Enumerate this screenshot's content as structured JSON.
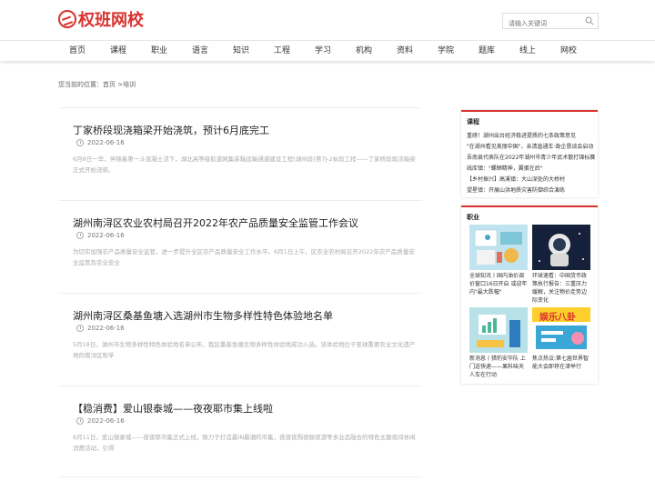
{
  "header": {
    "logo_text": "权班网校",
    "search_placeholder": "请输入关键词"
  },
  "nav": {
    "items": [
      "首页",
      "课程",
      "职业",
      "语言",
      "知识",
      "工程",
      "学习",
      "机构",
      "资料",
      "学院",
      "题库",
      "线上",
      "网校"
    ]
  },
  "breadcrumb": {
    "text": "您当前的位置：首页 >培训"
  },
  "articles": [
    {
      "title": "丁家桥段现浇箱梁开始浇筑，预计6月底完工",
      "date": "2022-06-16",
      "summary": "6月8日一早，伴随着第一斗混凝土浇下，湖北高等级航道网集装箱运输通道建设工程(湖州段)第7J-2标段工程——丁家桥段现浇箱梁正式开始浇筑。"
    },
    {
      "title": "湖州南浔区农业农村局召开2022年农产品质量安全监管工作会议",
      "date": "2022-06-16",
      "summary": "为切实加强农产品质量安全监管，进一步提升全区农产品质量安全工作水平。6月1日上午，区农业农村局召开2022年农产品质量安全监管及农业安全"
    },
    {
      "title": "湖州南浔区桑基鱼塘入选湖州市生物多样性特色体验地名单",
      "date": "2022-06-16",
      "summary": "5月18日，湖州市生物多样性特色体验地名单公布，我区桑基鱼塘生物多样性体验地成功入选。该体验地位于至球重要农业文化遗产地的南浔区和孚"
    },
    {
      "title": "【稳消费】爱山银泰城——夜夜耶市集上线啦",
      "date": "2022-06-16",
      "summary": "6月11日，爱山银泰城——夜夜耶市集正式上线，致力于打造最IN最潮的市集，夜夜夜购夜娱夜游等多业态融合的特色主题夜间休闲消费活动，引得"
    }
  ],
  "sidebar": {
    "course": {
      "title": "课程",
      "items": [
        "重磅！湖州出台经济稳进提质的七条政策意见",
        "\"在湖州看见美丽中国\"，亲清直通车·政企恳谈会启动",
        "吾南县代表队在2022年湖州市青少年武术散打锦标赛",
        "线库镇：\"螺蛳精神，翼蛋在后\"",
        "【乡村振兴】高溪镇：大山深处的大桥村",
        "望星镇：开展山洪地质灾害防御综合演练"
      ]
    },
    "jobs": {
      "title": "职业",
      "cards": [
        {
          "caption": "全球知讯丨国内油价调价窗口16日开启 或迎年内\"最大跌幅\""
        },
        {
          "caption": "环球速看：中国货币政策执行报告：三重压力缓解，关注物价走势边际变化"
        },
        {
          "caption": "新消息丨猎豹安华队 上门送快递——果料味天人车在行动"
        },
        {
          "caption": "焦点热议:第七届世界智能大会即将在津举行"
        }
      ],
      "banner_text": "娱乐八卦"
    }
  },
  "colors": {
    "brand": "#d9322f"
  }
}
